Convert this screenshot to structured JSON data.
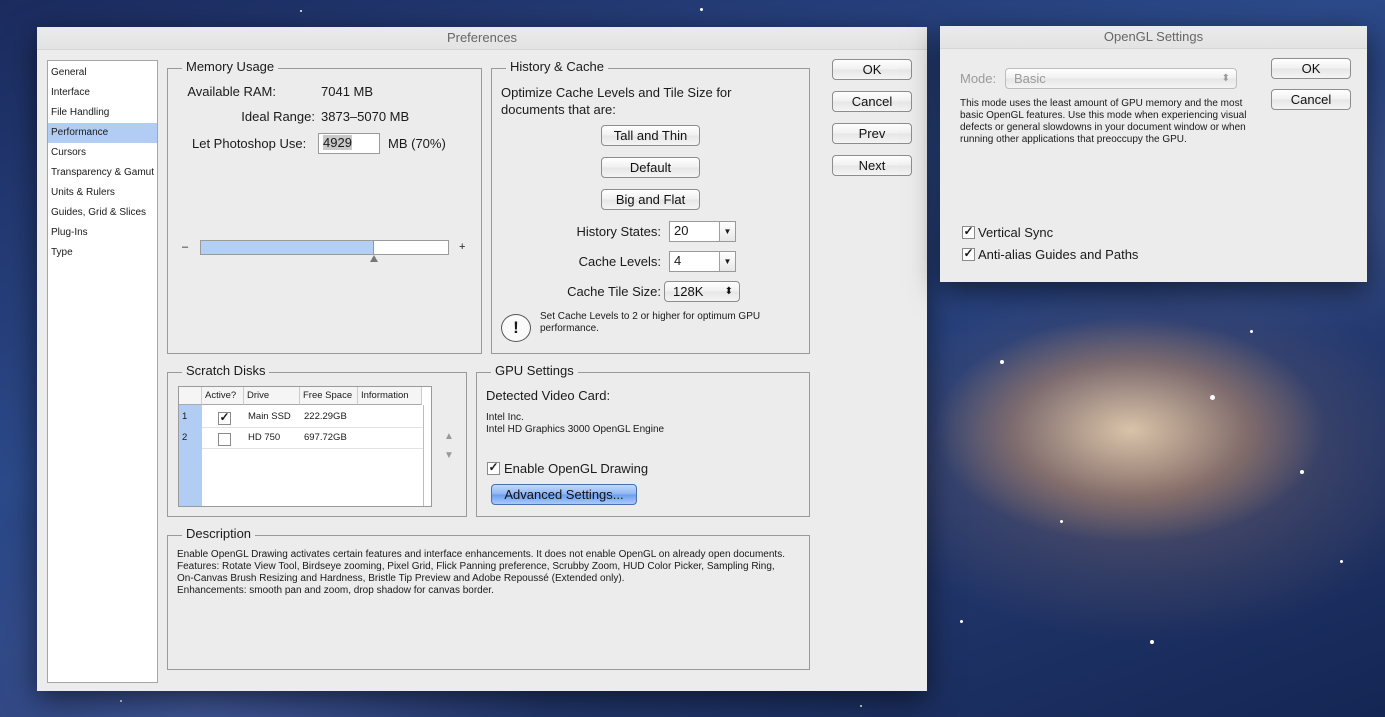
{
  "preferences": {
    "title": "Preferences",
    "sidebar": [
      "General",
      "Interface",
      "File Handling",
      "Performance",
      "Cursors",
      "Transparency & Gamut",
      "Units & Rulers",
      "Guides, Grid & Slices",
      "Plug-Ins",
      "Type"
    ],
    "buttons": {
      "ok": "OK",
      "cancel": "Cancel",
      "prev": "Prev",
      "next": "Next"
    },
    "memory": {
      "title": "Memory Usage",
      "available_label": "Available RAM:",
      "available_value": "7041 MB",
      "ideal_label": "Ideal Range:",
      "ideal_value": "3873–5070 MB",
      "use_label": "Let Photoshop Use:",
      "use_value": "4929",
      "use_unit": "MB (70%)",
      "slider_fraction": 0.7,
      "minus": "–",
      "plus": "+"
    },
    "history": {
      "title": "History & Cache",
      "intro": "Optimize Cache Levels and Tile Size for documents that are:",
      "btn_tall": "Tall and Thin",
      "btn_default": "Default",
      "btn_big": "Big and Flat",
      "states_label": "History States:",
      "states_value": "20",
      "levels_label": "Cache Levels:",
      "levels_value": "4",
      "tile_label": "Cache Tile Size:",
      "tile_value": "128K",
      "warning": "Set Cache Levels to 2 or higher for optimum GPU performance.",
      "warning_icon": "!"
    },
    "scratch": {
      "title": "Scratch Disks",
      "headers": [
        "Active?",
        "Drive",
        "Free Space",
        "Information"
      ],
      "rows": [
        {
          "num": "1",
          "active": true,
          "drive": "Main SSD",
          "free": "222.29GB",
          "info": ""
        },
        {
          "num": "2",
          "active": false,
          "drive": "HD 750",
          "free": "697.72GB",
          "info": ""
        }
      ],
      "up": "▲",
      "down": "▼"
    },
    "gpu": {
      "title": "GPU Settings",
      "detected_label": "Detected Video Card:",
      "vendor": "Intel Inc.",
      "card": "Intel HD Graphics 3000 OpenGL Engine",
      "enable_label": "Enable OpenGL Drawing",
      "enable_checked": true,
      "advanced": "Advanced Settings..."
    },
    "description": {
      "title": "Description",
      "text": "Enable OpenGL Drawing activates certain features and interface enhancements. It does not enable OpenGL on already open documents.\nFeatures: Rotate View Tool, Birdseye zooming, Pixel Grid, Flick Panning preference, Scrubby Zoom, HUD Color Picker, Sampling Ring, On-Canvas Brush Resizing and Hardness, Bristle Tip Preview and Adobe Repoussé (Extended only).\nEnhancements: smooth pan and zoom, drop shadow for canvas border."
    }
  },
  "opengl": {
    "title": "OpenGL Settings",
    "mode_label": "Mode:",
    "mode_value": "Basic",
    "mode_desc": "This mode uses the least amount of GPU memory and the most basic OpenGL features.  Use this mode when experiencing visual defects or general slowdowns in your document window or when running other applications that preoccupy the GPU.",
    "ok": "OK",
    "cancel": "Cancel",
    "vsync_label": "Vertical Sync",
    "vsync_checked": true,
    "antialias_label": "Anti-alias Guides and Paths",
    "antialias_checked": true
  },
  "colors": {
    "selection": "#b1cdf3",
    "slider_fill": "#b4cff4",
    "window_bg": "#ececec"
  },
  "icons": {
    "check": "✓",
    "spinner": "⬍"
  }
}
